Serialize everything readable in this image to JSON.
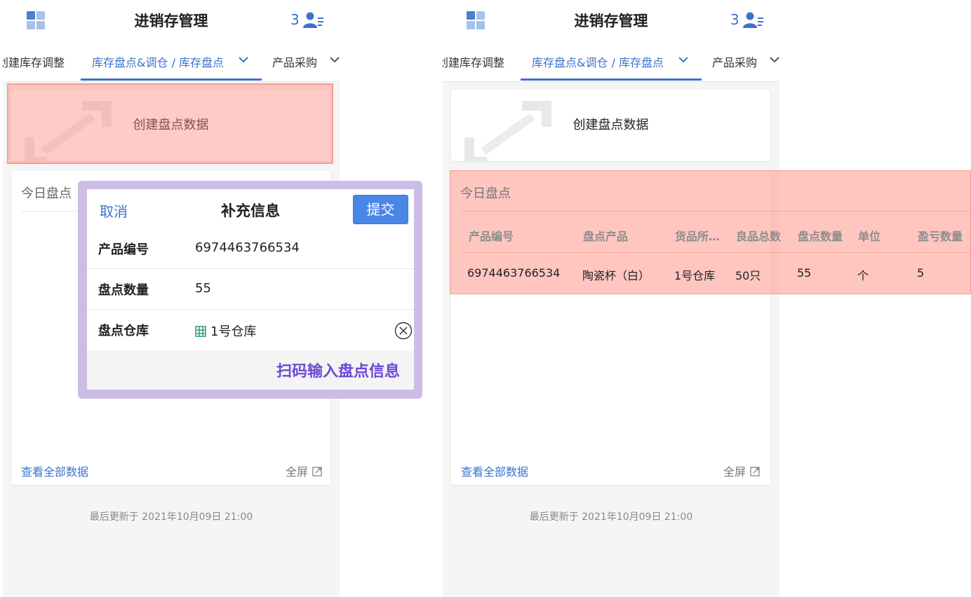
{
  "app": {
    "title": "进销存管理",
    "user_count": "3"
  },
  "tabs": [
    {
      "label": "创建库存调整"
    },
    {
      "label": "库存盘点&调仓 / 库存盘点"
    },
    {
      "label": "产品采购"
    }
  ],
  "create_card": {
    "label": "创建盘点数据"
  },
  "today_card": {
    "title": "今日盘点",
    "view_all": "查看全部数据",
    "fullscreen": "全屏"
  },
  "updated": "最后更新于 2021年10月09日 21:00",
  "modal": {
    "cancel": "取消",
    "title": "补充信息",
    "submit": "提交",
    "fields": [
      {
        "label": "产品编号",
        "value": "6974463766534"
      },
      {
        "label": "盘点数量",
        "value": "55"
      },
      {
        "label": "盘点仓库",
        "value": "1号仓库"
      }
    ]
  },
  "annotation": {
    "scan_text": "扫码输入盘点信息"
  },
  "table": {
    "headers": [
      "产品编号",
      "盘点产品",
      "货品所…",
      "良品总数",
      "盘点数量",
      "单位",
      "盈亏数量"
    ],
    "rows": [
      [
        "6974463766534",
        "陶瓷杯（白）",
        "1号仓库",
        "50只",
        "55",
        "个",
        "5"
      ]
    ]
  },
  "colors": {
    "accent": "#3b73cc",
    "submit_bg": "#4a86e8",
    "highlight_red": "#ff8c82",
    "highlight_purple": "#cdbde6",
    "annotation_text": "#6b48d6"
  }
}
